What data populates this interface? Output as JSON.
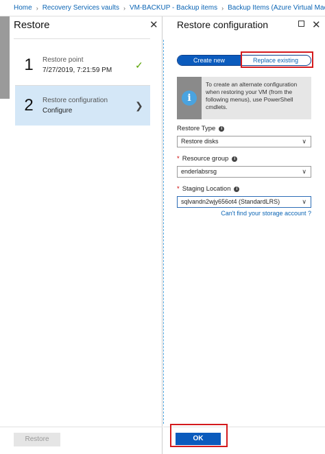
{
  "breadcrumb": [
    "Home",
    "Recovery Services vaults",
    "VM-BACKUP - Backup items",
    "Backup Items (Azure Virtual Machine"
  ],
  "left_blade": {
    "title": "Restore",
    "steps": [
      {
        "number": "1",
        "title": "Restore point",
        "subtitle": "7/27/2019, 7:21:59 PM",
        "state": "complete"
      },
      {
        "number": "2",
        "title": "Restore configuration",
        "subtitle": "Configure",
        "state": "active"
      }
    ],
    "restore_button": "Restore"
  },
  "right_blade": {
    "title": "Restore configuration",
    "toggle": {
      "create_new": "Create new",
      "replace_existing": "Replace existing",
      "selected": "Create new"
    },
    "info_text": "To create an alternate configuration when restoring your VM (from the following menus), use PowerShell cmdlets.",
    "restore_type": {
      "label": "Restore Type",
      "value": "Restore disks"
    },
    "resource_group": {
      "label": "Resource group",
      "value": "enderlabsrsg"
    },
    "staging_location": {
      "label": "Staging Location",
      "value": "sqlvandn2wjy656ot4 (StandardLRS)"
    },
    "storage_link": "Can't find your storage account ?",
    "ok_button": "OK"
  },
  "colors": {
    "accent": "#0b5bbd",
    "highlight": "#d4191c",
    "active_step": "#d4e7f7",
    "check": "#57a300"
  }
}
